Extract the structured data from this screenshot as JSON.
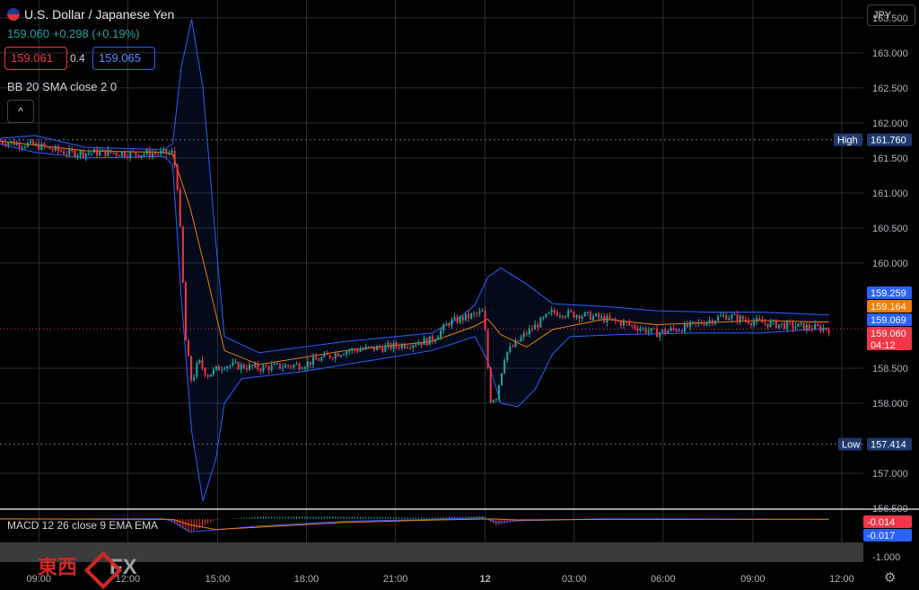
{
  "header": {
    "symbol": "U.S. Dollar / Japanese Yen",
    "quote": "159.060 +0.298 (+0.19%)",
    "bid": "159.061",
    "spread": "0.4",
    "ask": "159.065",
    "indicator": "BB 20 SMA close 2 0",
    "collapse": "^",
    "currency": "JPY",
    "macd_label": "MACD 12 26 close 9 EMA EMA"
  },
  "watermark": {
    "cn": "東西",
    "fx": "FX"
  },
  "chart_data": [
    {
      "type": "candlestick",
      "pair": "U.S. Dollar / Japanese Yen",
      "ylim": [
        156.5,
        163.6
      ],
      "yticks": [
        "163.500",
        "163.000",
        "162.500",
        "162.000",
        "161.500",
        "161.000",
        "160.500",
        "160.000",
        "158.500",
        "158.000",
        "157.000",
        "156.500"
      ],
      "xticks": [
        "09:00",
        "12:00",
        "15:00",
        "18:00",
        "21:00",
        "12",
        "03:00",
        "06:00",
        "09:00",
        "12:00"
      ],
      "xtick_pos": [
        0.045,
        0.148,
        0.252,
        0.355,
        0.458,
        0.562,
        0.665,
        0.768,
        0.872,
        0.975
      ],
      "labels": {
        "high": {
          "label": "High",
          "value": 161.76,
          "text": "161.760",
          "color": "#1e3a6e"
        },
        "low": {
          "label": "Low",
          "value": 157.414,
          "text": "157.414",
          "color": "#1e3a6e"
        },
        "bb_upper": {
          "value": 159.259,
          "text": "159.259",
          "color": "#2962ff"
        },
        "sma": {
          "value": 159.164,
          "text": "159.164",
          "color": "#f57c00"
        },
        "bb_lower": {
          "value": 159.069,
          "text": "159.069",
          "color": "#2962ff"
        },
        "last": {
          "value": 159.06,
          "text": "159.060",
          "color": "#f23645"
        },
        "countdown": "04:12"
      },
      "price_path": [
        [
          0.0,
          161.74
        ],
        [
          0.04,
          161.68
        ],
        [
          0.08,
          161.57
        ],
        [
          0.12,
          161.58
        ],
        [
          0.16,
          161.56
        ],
        [
          0.2,
          161.57
        ],
        [
          0.205,
          161.2
        ],
        [
          0.21,
          160.2
        ],
        [
          0.215,
          158.9
        ],
        [
          0.222,
          158.3
        ],
        [
          0.23,
          158.6
        ],
        [
          0.24,
          158.4
        ],
        [
          0.26,
          158.55
        ],
        [
          0.3,
          158.5
        ],
        [
          0.35,
          158.55
        ],
        [
          0.4,
          158.75
        ],
        [
          0.45,
          158.8
        ],
        [
          0.5,
          158.9
        ],
        [
          0.52,
          159.15
        ],
        [
          0.56,
          159.3
        ],
        [
          0.568,
          158.05
        ],
        [
          0.575,
          158.1
        ],
        [
          0.585,
          158.7
        ],
        [
          0.61,
          159.0
        ],
        [
          0.64,
          159.3
        ],
        [
          0.68,
          159.25
        ],
        [
          0.72,
          159.15
        ],
        [
          0.76,
          159.0
        ],
        [
          0.8,
          159.1
        ],
        [
          0.84,
          159.25
        ],
        [
          0.88,
          159.15
        ],
        [
          0.92,
          159.1
        ],
        [
          0.96,
          159.06
        ]
      ],
      "bb_upper_path": [
        [
          0.0,
          161.78
        ],
        [
          0.04,
          161.82
        ],
        [
          0.1,
          161.65
        ],
        [
          0.19,
          161.62
        ],
        [
          0.2,
          161.7
        ],
        [
          0.21,
          162.8
        ],
        [
          0.222,
          163.48
        ],
        [
          0.235,
          162.5
        ],
        [
          0.25,
          160.3
        ],
        [
          0.26,
          158.95
        ],
        [
          0.3,
          158.72
        ],
        [
          0.4,
          158.88
        ],
        [
          0.5,
          159.0
        ],
        [
          0.53,
          159.2
        ],
        [
          0.55,
          159.4
        ],
        [
          0.565,
          159.8
        ],
        [
          0.58,
          159.93
        ],
        [
          0.61,
          159.7
        ],
        [
          0.64,
          159.42
        ],
        [
          0.7,
          159.38
        ],
        [
          0.76,
          159.32
        ],
        [
          0.82,
          159.3
        ],
        [
          0.88,
          159.3
        ],
        [
          0.94,
          159.27
        ],
        [
          0.96,
          159.26
        ]
      ],
      "bb_lower_path": [
        [
          0.0,
          161.7
        ],
        [
          0.04,
          161.58
        ],
        [
          0.1,
          161.5
        ],
        [
          0.19,
          161.52
        ],
        [
          0.2,
          161.4
        ],
        [
          0.21,
          159.5
        ],
        [
          0.222,
          157.6
        ],
        [
          0.235,
          156.6
        ],
        [
          0.25,
          157.2
        ],
        [
          0.26,
          158.0
        ],
        [
          0.28,
          158.35
        ],
        [
          0.35,
          158.45
        ],
        [
          0.45,
          158.65
        ],
        [
          0.5,
          158.75
        ],
        [
          0.55,
          158.95
        ],
        [
          0.565,
          158.6
        ],
        [
          0.58,
          158.0
        ],
        [
          0.6,
          157.95
        ],
        [
          0.62,
          158.2
        ],
        [
          0.64,
          158.7
        ],
        [
          0.66,
          158.95
        ],
        [
          0.72,
          158.98
        ],
        [
          0.8,
          159.0
        ],
        [
          0.88,
          159.0
        ],
        [
          0.94,
          159.05
        ],
        [
          0.96,
          159.07
        ]
      ],
      "sma_path": [
        [
          0.0,
          161.74
        ],
        [
          0.1,
          161.6
        ],
        [
          0.19,
          161.58
        ],
        [
          0.2,
          161.55
        ],
        [
          0.22,
          160.8
        ],
        [
          0.24,
          159.8
        ],
        [
          0.26,
          158.75
        ],
        [
          0.3,
          158.55
        ],
        [
          0.4,
          158.75
        ],
        [
          0.5,
          158.88
        ],
        [
          0.55,
          159.1
        ],
        [
          0.565,
          159.2
        ],
        [
          0.58,
          158.98
        ],
        [
          0.61,
          158.8
        ],
        [
          0.64,
          159.05
        ],
        [
          0.7,
          159.2
        ],
        [
          0.76,
          159.12
        ],
        [
          0.82,
          159.15
        ],
        [
          0.88,
          159.18
        ],
        [
          0.94,
          159.16
        ],
        [
          0.96,
          159.16
        ]
      ]
    },
    {
      "type": "macd",
      "ylim": [
        -1.0,
        0.3
      ],
      "yticks": [
        "-1.000"
      ],
      "labels": {
        "macd": {
          "value": -0.014,
          "text": "-0.014",
          "color": "#f23645"
        },
        "signal": {
          "value": -0.017,
          "text": "-0.017",
          "color": "#2962ff"
        }
      },
      "macd_path": [
        [
          0.0,
          0.0
        ],
        [
          0.19,
          0.0
        ],
        [
          0.2,
          -0.1
        ],
        [
          0.22,
          -0.55
        ],
        [
          0.24,
          -0.5
        ],
        [
          0.3,
          -0.3
        ],
        [
          0.4,
          -0.1
        ],
        [
          0.5,
          -0.02
        ],
        [
          0.56,
          0.05
        ],
        [
          0.575,
          -0.15
        ],
        [
          0.6,
          -0.08
        ],
        [
          0.7,
          0.0
        ],
        [
          0.96,
          -0.014
        ]
      ],
      "signal_path": [
        [
          0.0,
          0.0
        ],
        [
          0.2,
          -0.02
        ],
        [
          0.22,
          -0.25
        ],
        [
          0.25,
          -0.45
        ],
        [
          0.3,
          -0.35
        ],
        [
          0.4,
          -0.15
        ],
        [
          0.5,
          -0.05
        ],
        [
          0.57,
          0.0
        ],
        [
          0.6,
          -0.05
        ],
        [
          0.7,
          -0.02
        ],
        [
          0.96,
          -0.017
        ]
      ]
    }
  ]
}
